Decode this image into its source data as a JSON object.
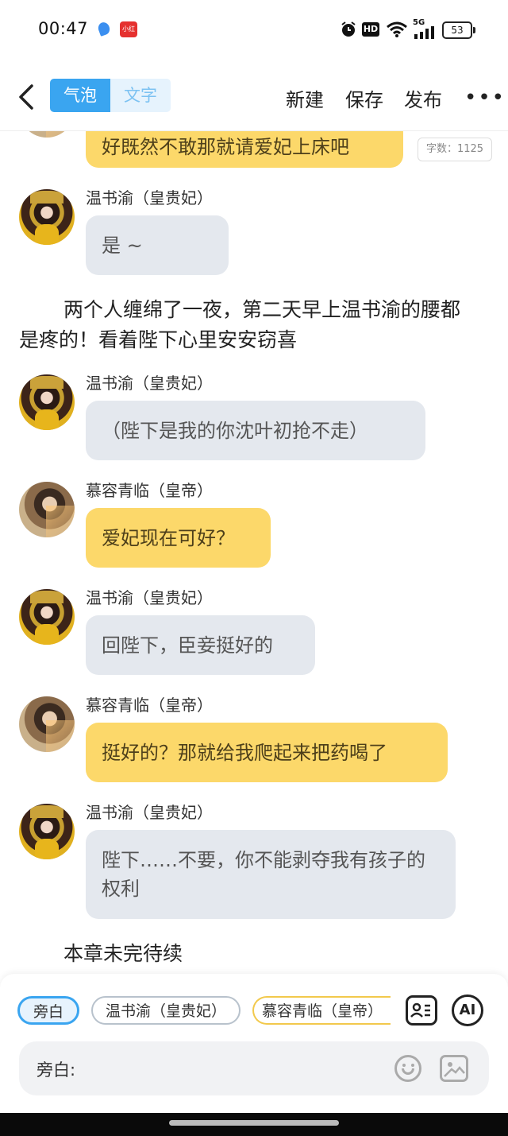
{
  "status_bar": {
    "time": "00:47",
    "app_icon_text": "小红书",
    "network": "5G",
    "hd": "HD",
    "battery": "53"
  },
  "header": {
    "tab_bubble": "气泡",
    "tab_text": "文字",
    "new_label": "新建",
    "save_label": "保存",
    "publish_label": "发布",
    "more_label": "•••"
  },
  "word_count": "字数：1125",
  "messages": [
    {
      "type": "bubble",
      "speaker": "",
      "text": "好既然不敢那就请爱妃上床吧",
      "color": "yellow"
    },
    {
      "type": "bubble",
      "speaker": "温书渝（皇贵妃）",
      "text": "是 ~",
      "color": "gray"
    },
    {
      "type": "narration",
      "text": "两个人缠绵了一夜，第二天早上温书渝的腰都是疼的！看着陛下心里安安窃喜"
    },
    {
      "type": "bubble",
      "speaker": "温书渝（皇贵妃）",
      "text": "（陛下是我的你沈叶初抢不走）",
      "color": "gray"
    },
    {
      "type": "bubble",
      "speaker": "慕容青临（皇帝）",
      "text": "爱妃现在可好？",
      "color": "yellow"
    },
    {
      "type": "bubble",
      "speaker": "温书渝（皇贵妃）",
      "text": "回陛下，臣妾挺好的",
      "color": "gray"
    },
    {
      "type": "bubble",
      "speaker": "慕容青临（皇帝）",
      "text": "挺好的？那就给我爬起来把药喝了",
      "color": "yellow"
    },
    {
      "type": "bubble",
      "speaker": "温书渝（皇贵妃）",
      "text": "陛下……不要，你不能剥夺我有孩子的权利",
      "color": "gray"
    },
    {
      "type": "narration",
      "text": "本章未完待续"
    }
  ],
  "composer": {
    "chips": [
      "旁白",
      "温书渝（皇贵妃）",
      "慕容青临（皇帝）"
    ],
    "ai_label": "AI",
    "input_label": "旁白:"
  },
  "colors": {
    "accent": "#3aa5f0",
    "bubble_gray": "#e4e8ee",
    "bubble_yellow": "#fcd86a"
  }
}
